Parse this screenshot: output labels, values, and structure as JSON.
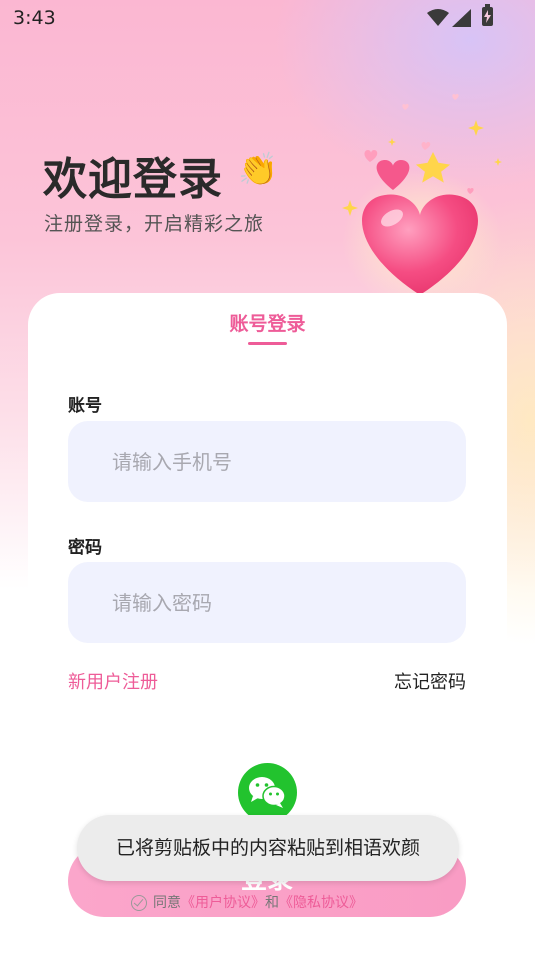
{
  "status_bar": {
    "time": "3:43",
    "icons": [
      "wifi-icon",
      "signal-icon",
      "battery-charging-icon"
    ]
  },
  "header": {
    "title": "欢迎登录",
    "title_emoji": "👏",
    "subtitle": "注册登录，开启精彩之旅",
    "decoration": "hearts-illustration"
  },
  "login_card": {
    "tab_label": "账号登录",
    "account": {
      "label": "账号",
      "placeholder": "请输入手机号",
      "value": ""
    },
    "password": {
      "label": "密码",
      "placeholder": "请输入密码",
      "value": ""
    },
    "register_link": "新用户注册",
    "forgot_link": "忘记密码"
  },
  "wechat_login": {
    "icon": "wechat-icon"
  },
  "login_button": {
    "label": "登录"
  },
  "agreement": {
    "prefix": "同意",
    "user_agreement": "《用户协议》",
    "conjunction": "和",
    "privacy_agreement": "《隐私协议》"
  },
  "toast": {
    "message": "已将剪贴板中的内容粘贴到相语欢颜"
  },
  "colors": {
    "accent": "#ee5c98",
    "input_bg": "#f0f2fe",
    "wechat_green": "#22c32e",
    "button_pink": "#fba6cb"
  }
}
